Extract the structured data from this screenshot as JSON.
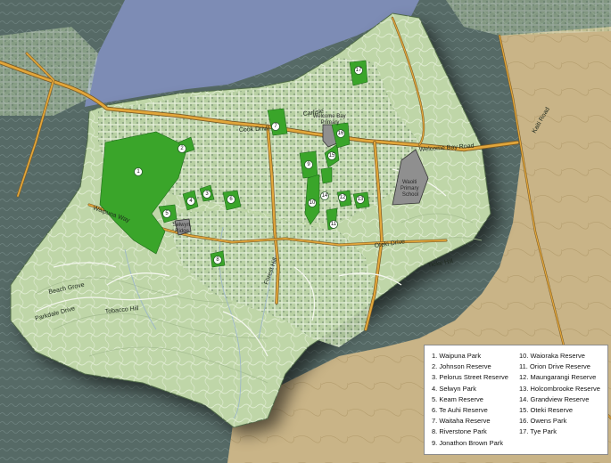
{
  "legend": {
    "items": [
      "1. Waipuna Park",
      "2. Johnson Reserve",
      "3. Pelorus Street Reserve",
      "4. Selwyn Park",
      "5. Keam Reserve",
      "6. Te Auhi Reserve",
      "7. Waitaha Reserve",
      "8. Riverstone Park",
      "9. Jonathon Brown Park",
      "10. Waioraka Reserve",
      "11. Orion Drive Reserve",
      "12. Maungarangi Reserve",
      "13. Holcombrooke Reserve",
      "14. Grandview Reserve",
      "15. Oteki Reserve",
      "16. Owens Park",
      "17. Tye Park"
    ]
  },
  "map": {
    "roads": {
      "cook_drive": "Cook Drive",
      "welcome_bay_road": "Welcome Bay Road",
      "waipuna_way": "Waipuna Way",
      "carlisle": "Carlisle",
      "tieke_hill": "Tieke Hill",
      "beach_grove": "Beach Grove",
      "tobacco_hill": "Tobacco Hill",
      "forest_hill": "Forest Hill",
      "parkdale": "Parkdale Drive",
      "oteki_drive": "Oteki Drive",
      "kaiti_road": "Kaiti Road"
    },
    "places": {
      "welcome_bay_primary": [
        "Welcome Bay",
        "Primary"
      ],
      "selwyn_ridge": [
        "Selwyn",
        "Ridge"
      ],
      "waoiti_school": [
        "Waoiti",
        "Primary",
        "School"
      ]
    },
    "markers": [
      "1",
      "2",
      "3",
      "4",
      "5",
      "6",
      "7",
      "8",
      "9",
      "10",
      "11",
      "12",
      "13",
      "14",
      "15",
      "16",
      "17"
    ]
  },
  "colors": {
    "water": "#7d8cb5",
    "suburb": "#bfd6a8",
    "park": "#3aa52a",
    "farmland": "#c9b487",
    "outside_shaded": "#5b6e6a",
    "road_main": "#e2a63a",
    "school": "#8f8f8f"
  }
}
